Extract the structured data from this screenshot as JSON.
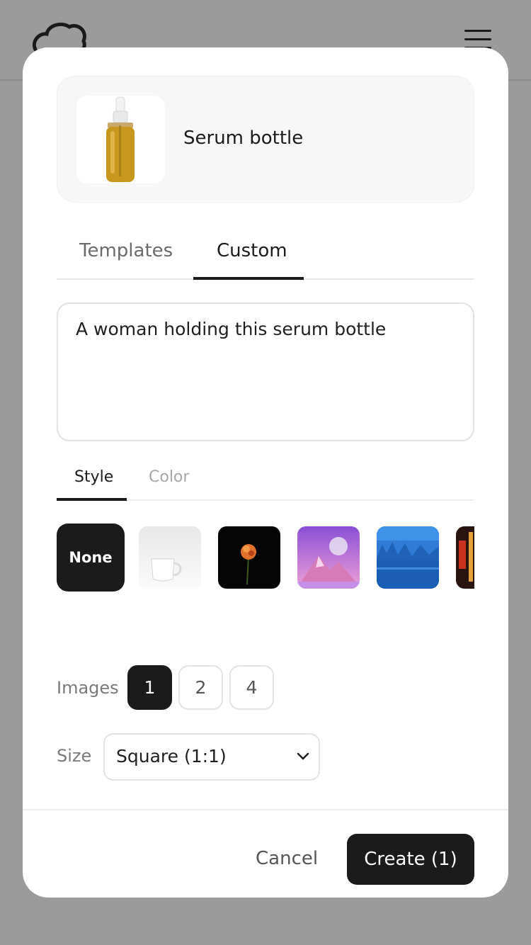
{
  "product": {
    "name": "Serum bottle",
    "thumbnail_icon": "serum-bottle-image"
  },
  "tabs": {
    "templates": "Templates",
    "custom": "Custom",
    "active": "Custom"
  },
  "prompt": {
    "value": "A woman holding this serum bottle"
  },
  "subtabs": {
    "style": "Style",
    "color": "Color",
    "active": "Style"
  },
  "styles": {
    "selected": "None",
    "none_label": "None",
    "options": [
      "mug",
      "flower",
      "mountain-sphere",
      "lake",
      "neon"
    ]
  },
  "images": {
    "label": "Images",
    "options": [
      "1",
      "2",
      "4"
    ],
    "selected": "1"
  },
  "size": {
    "label": "Size",
    "value": "Square (1:1)"
  },
  "footer": {
    "cancel": "Cancel",
    "create": "Create (1)"
  }
}
